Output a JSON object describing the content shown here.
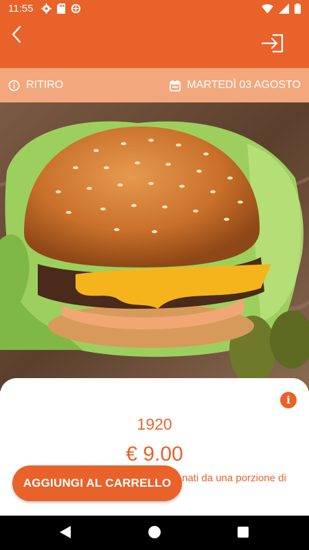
{
  "status_bar": {
    "time": "11:55"
  },
  "header": {
    "back_icon": "chevron-left-icon",
    "login_icon": "login-icon"
  },
  "info_bar": {
    "mode": "RITIRO",
    "date": "MARTEDÌ 03 AGOSTO"
  },
  "product": {
    "name": "1920",
    "price": "€ 9.00",
    "description_visible": "nati da una porzione di"
  },
  "cart_button": {
    "label": "AGGIUNGI AL CARRELLO"
  },
  "colors": {
    "primary": "#e8622a",
    "info_bar": "#f2a87c"
  }
}
